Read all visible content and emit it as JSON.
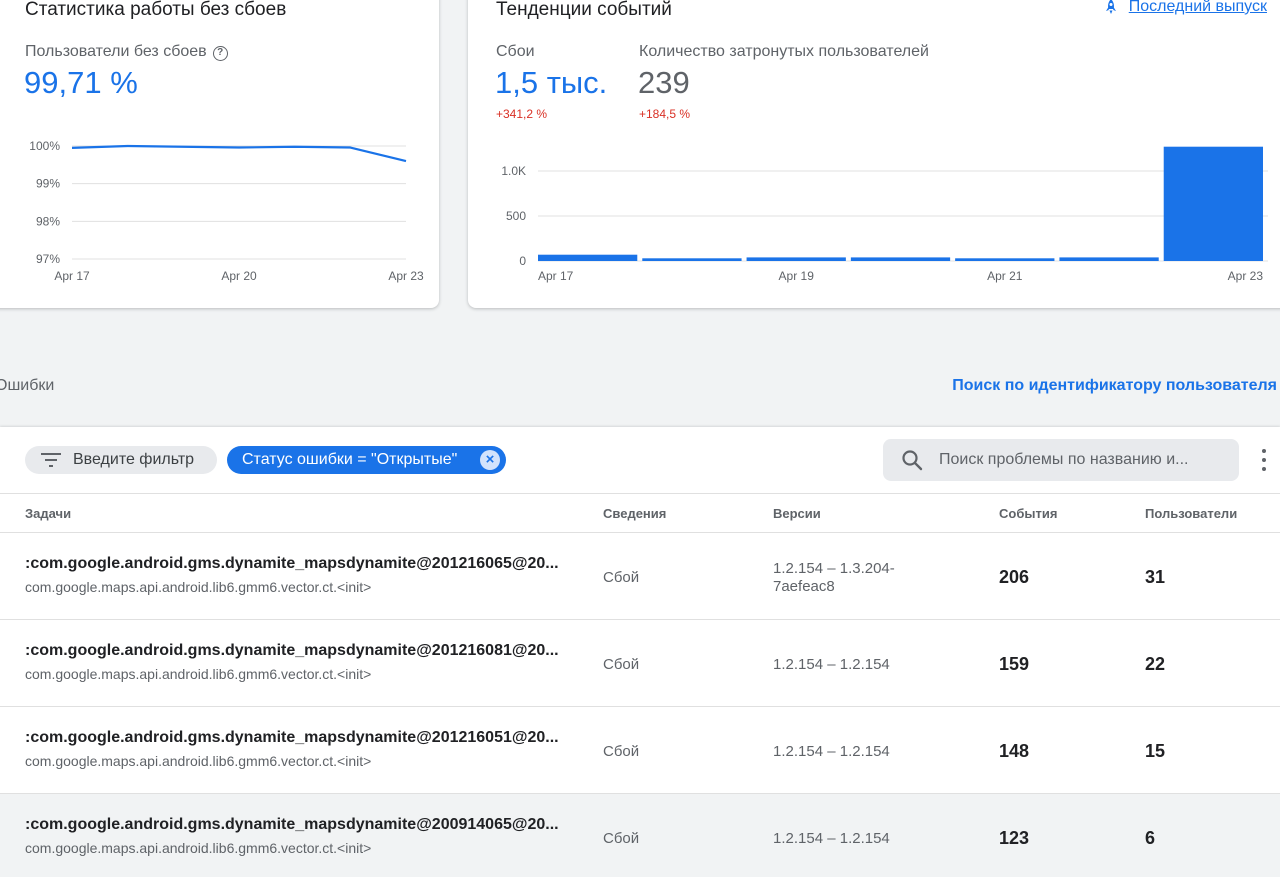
{
  "stability": {
    "title": "Статистика работы без сбоев",
    "metric_label": "Пользователи без сбоев",
    "metric_value": "99,71 %",
    "chart_data": {
      "type": "line",
      "x_ticks": [
        "Apr 17",
        "Apr 20",
        "Apr 23"
      ],
      "y_ticks": [
        "100%",
        "99%",
        "98%",
        "97%"
      ],
      "ylim": [
        97,
        100
      ],
      "points": [
        {
          "day": 17,
          "value": 99.95
        },
        {
          "day": 18,
          "value": 100.0
        },
        {
          "day": 19,
          "value": 99.98
        },
        {
          "day": 20,
          "value": 99.96
        },
        {
          "day": 21,
          "value": 99.98
        },
        {
          "day": 22,
          "value": 99.96
        },
        {
          "day": 23,
          "value": 99.6
        }
      ],
      "color": "#1a73e8",
      "grid": true
    }
  },
  "trends": {
    "title": "Тенденции событий",
    "latest_link": "Последний выпуск",
    "crashes_label": "Сбои",
    "crashes_value": "1,5 тыс.",
    "crashes_delta": "+341,2 %",
    "users_label": "Количество затронутых пользователей",
    "users_value": "239",
    "users_delta": "+184,5 %",
    "chart_data": {
      "type": "bar",
      "categories": [
        "Apr 17",
        "Apr 18",
        "Apr 19",
        "Apr 20",
        "Apr 21",
        "Apr 22",
        "Apr 23"
      ],
      "x_ticks": [
        "Apr 17",
        "Apr 19",
        "Apr 21",
        "Apr 23"
      ],
      "y_ticks": [
        "1.0K",
        "500",
        "0"
      ],
      "ylim": [
        0,
        1000
      ],
      "values": [
        70,
        30,
        40,
        40,
        30,
        40,
        1270
      ],
      "color": "#1a73e8",
      "grid": true
    }
  },
  "errors_section": {
    "title": "Ошибки",
    "search_user_link": "Поиск по идентификатору пользователя"
  },
  "toolbar": {
    "filter_label": "Введите фильтр",
    "status_chip": "Статус ошибки = \"Открытые\"",
    "search_placeholder": "Поиск проблемы по названию и..."
  },
  "table": {
    "headers": {
      "issues": "Задачи",
      "details": "Сведения",
      "versions": "Версии",
      "events": "События",
      "users": "Пользователи"
    },
    "rows": [
      {
        "title": ":com.google.android.gms.dynamite_mapsdynamite@201216065@20...",
        "subtitle": "com.google.maps.api.android.lib6.gmm6.vector.ct.<init>",
        "details": "Сбой",
        "versions": "1.2.154 – 1.3.204-7aefeac8",
        "events": "206",
        "users": "31"
      },
      {
        "title": ":com.google.android.gms.dynamite_mapsdynamite@201216081@20...",
        "subtitle": "com.google.maps.api.android.lib6.gmm6.vector.ct.<init>",
        "details": "Сбой",
        "versions": "1.2.154 – 1.2.154",
        "events": "159",
        "users": "22"
      },
      {
        "title": ":com.google.android.gms.dynamite_mapsdynamite@201216051@20...",
        "subtitle": "com.google.maps.api.android.lib6.gmm6.vector.ct.<init>",
        "details": "Сбой",
        "versions": "1.2.154 – 1.2.154",
        "events": "148",
        "users": "15"
      },
      {
        "title": ":com.google.android.gms.dynamite_mapsdynamite@200914065@20...",
        "subtitle": "com.google.maps.api.android.lib6.gmm6.vector.ct.<init>",
        "details": "Сбой",
        "versions": "1.2.154 – 1.2.154",
        "events": "123",
        "users": "6"
      }
    ]
  }
}
